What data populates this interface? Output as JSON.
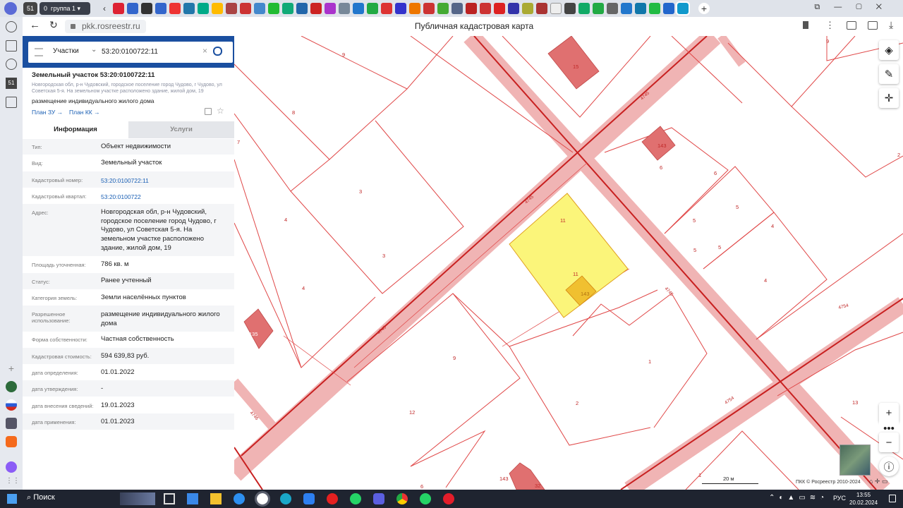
{
  "browser": {
    "tab_count": "51",
    "group_count": "0",
    "group_label": "группа 1",
    "url": "pkk.rosreestr.ru",
    "page_title": "Публичная кадастровая карта"
  },
  "search": {
    "category": "Участки",
    "query": "53:20:0100722:11"
  },
  "parcel": {
    "title": "Земельный участок 53:20:0100722:11",
    "address_small": "Новгородская обл, р-н Чудовский, городское поселение город Чудово, г Чудово, ул Советская 5-я. На земельном участке расположено здание, жилой дом, 19",
    "purpose": "размещение индивидуального жилого дома",
    "plan_zu": "План ЗУ",
    "plan_kk": "План КК"
  },
  "tabs": {
    "info": "Информация",
    "services": "Услуги"
  },
  "fields": [
    {
      "label": "Тип:",
      "value": "Объект недвижимости"
    },
    {
      "label": "Вид:",
      "value": "Земельный участок"
    },
    {
      "label": "Кадастровый номер:",
      "value": "53:20:0100722:11"
    },
    {
      "label": "Кадастровый квартал:",
      "value": "53:20:0100722"
    },
    {
      "label": "Адрес:",
      "value": "Новгородская обл, р-н Чудовский, городское поселение город Чудово, г Чудово, ул Советская 5-я. На земельном участке расположено здание, жилой дом, 19"
    },
    {
      "label": "Площадь уточненная:",
      "value": "786 кв. м"
    },
    {
      "label": "Статус:",
      "value": "Ранее учтенный"
    },
    {
      "label": "Категория земель:",
      "value": "Земли населённых пунктов"
    },
    {
      "label": "Разрешенное использование:",
      "value": "размещение индивидуального жилого дома"
    },
    {
      "label": "Форма собственности:",
      "value": "Частная собственность"
    },
    {
      "label": "Кадастровая стоимость:",
      "value": "594 639,83 руб."
    },
    {
      "label": "дата определения:",
      "value": "01.01.2022"
    },
    {
      "label": "дата утверждения:",
      "value": "-"
    },
    {
      "label": "дата внесения сведений:",
      "value": "19.01.2023"
    },
    {
      "label": "дата применения:",
      "value": "01.01.2023"
    }
  ],
  "map": {
    "labels": {
      "l9a": "9",
      "l8": "8",
      "l7": "7",
      "l3a": "3",
      "l4a": "4",
      "l3b": "3",
      "l4b": "4",
      "l9b": "9",
      "l12": "12",
      "l6a": "6",
      "l143a": "143",
      "l11a": "11",
      "l11b": "11",
      "l143b": "143",
      "l15": "15",
      "l143c": "143",
      "l6b": "6",
      "l6c": "6",
      "l5a": "5",
      "l5b": "5",
      "l5c": "5",
      "l5d": "5",
      "l4c": "4",
      "l4d": "4",
      "l1a": "1",
      "l2": "2",
      "l13": "13",
      "l1b": "1",
      "l9c": "9",
      "l2r": "2",
      "l135": "135",
      "l32": "32",
      "r4745a": "4745",
      "r4745b": "4745",
      "r4745c": "4745",
      "r4745d": "4745",
      "r4746": "4746",
      "r4754a": "4754",
      "r4754b": "4754"
    },
    "scale": "20 м",
    "copyright": "ПКК © Росреестр 2010-2024"
  },
  "taskbar": {
    "search": "Поиск",
    "lang": "РУС",
    "time": "13:55",
    "date": "20.02.2024"
  },
  "colors": {
    "brand": "#1a4fa0",
    "road": "#f0b4b4",
    "parcel_line": "#e04848",
    "selected": "#fbf57a"
  }
}
